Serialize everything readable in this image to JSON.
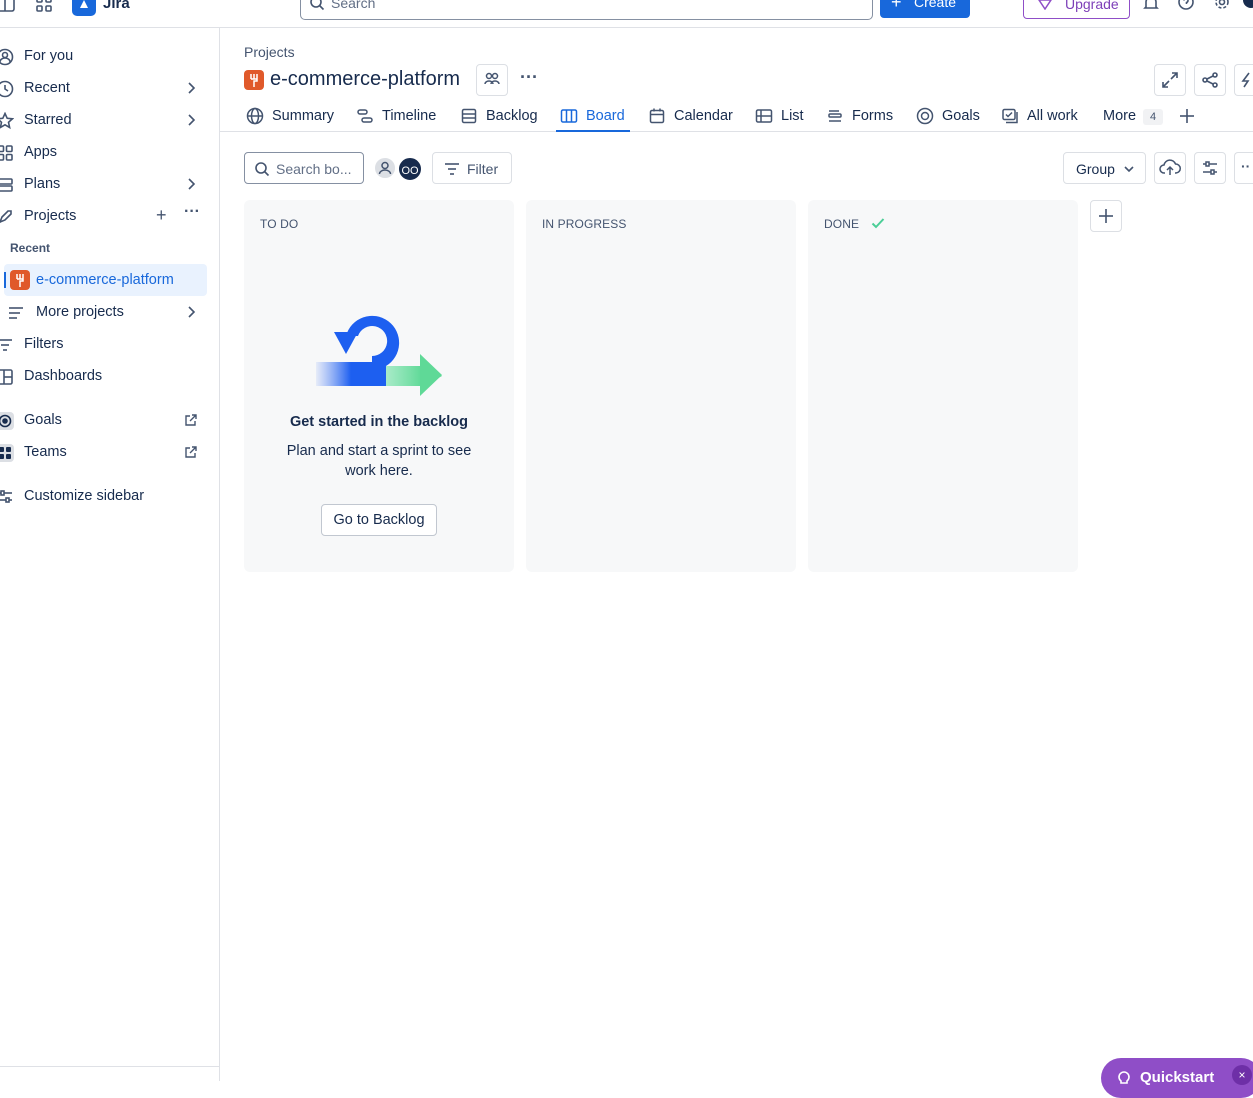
{
  "topbar": {
    "app_name": "Jira",
    "search_placeholder": "Search",
    "create_label": "Create",
    "upgrade_label": "Upgrade"
  },
  "sidebar": {
    "items": [
      {
        "label": "For you",
        "icon": "user-circle-icon"
      },
      {
        "label": "Recent",
        "icon": "clock-icon"
      },
      {
        "label": "Starred",
        "icon": "star-icon"
      },
      {
        "label": "Apps",
        "icon": "apps-grid-icon"
      },
      {
        "label": "Plans",
        "icon": "plans-icon"
      },
      {
        "label": "Projects",
        "icon": "rocket-icon"
      }
    ],
    "recent_heading": "Recent",
    "active_project": "e-commerce-platform",
    "more_projects": "More projects",
    "filters": "Filters",
    "dashboards": "Dashboards",
    "goals": "Goals",
    "teams": "Teams",
    "customize": "Customize sidebar"
  },
  "header": {
    "breadcrumb": "Projects",
    "title": "e-commerce-platform"
  },
  "tabs": [
    {
      "label": "Summary",
      "icon": "globe-icon"
    },
    {
      "label": "Timeline",
      "icon": "timeline-icon"
    },
    {
      "label": "Backlog",
      "icon": "backlog-icon"
    },
    {
      "label": "Board",
      "icon": "board-icon",
      "active": true
    },
    {
      "label": "Calendar",
      "icon": "calendar-icon"
    },
    {
      "label": "List",
      "icon": "list-icon"
    },
    {
      "label": "Forms",
      "icon": "forms-icon"
    },
    {
      "label": "Goals",
      "icon": "goal-icon"
    },
    {
      "label": "All work",
      "icon": "all-work-icon"
    },
    {
      "label": "More",
      "badge": "4"
    }
  ],
  "toolbar": {
    "search_placeholder": "Search bo...",
    "avatar_initials": "OO",
    "filter_label": "Filter",
    "group_label": "Group"
  },
  "board": {
    "columns": [
      {
        "name": "TO DO"
      },
      {
        "name": "IN PROGRESS"
      },
      {
        "name": "DONE"
      }
    ],
    "empty_state": {
      "title": "Get started in the backlog",
      "description": "Plan and start a sprint to see work here.",
      "button": "Go to Backlog"
    }
  },
  "quickstart": {
    "label": "Quickstart",
    "close": "×"
  },
  "colors": {
    "brand_blue": "#1868db",
    "upgrade_purple": "#7d3fb8",
    "project_orange": "#e0592a",
    "done_green": "#4bce97"
  }
}
